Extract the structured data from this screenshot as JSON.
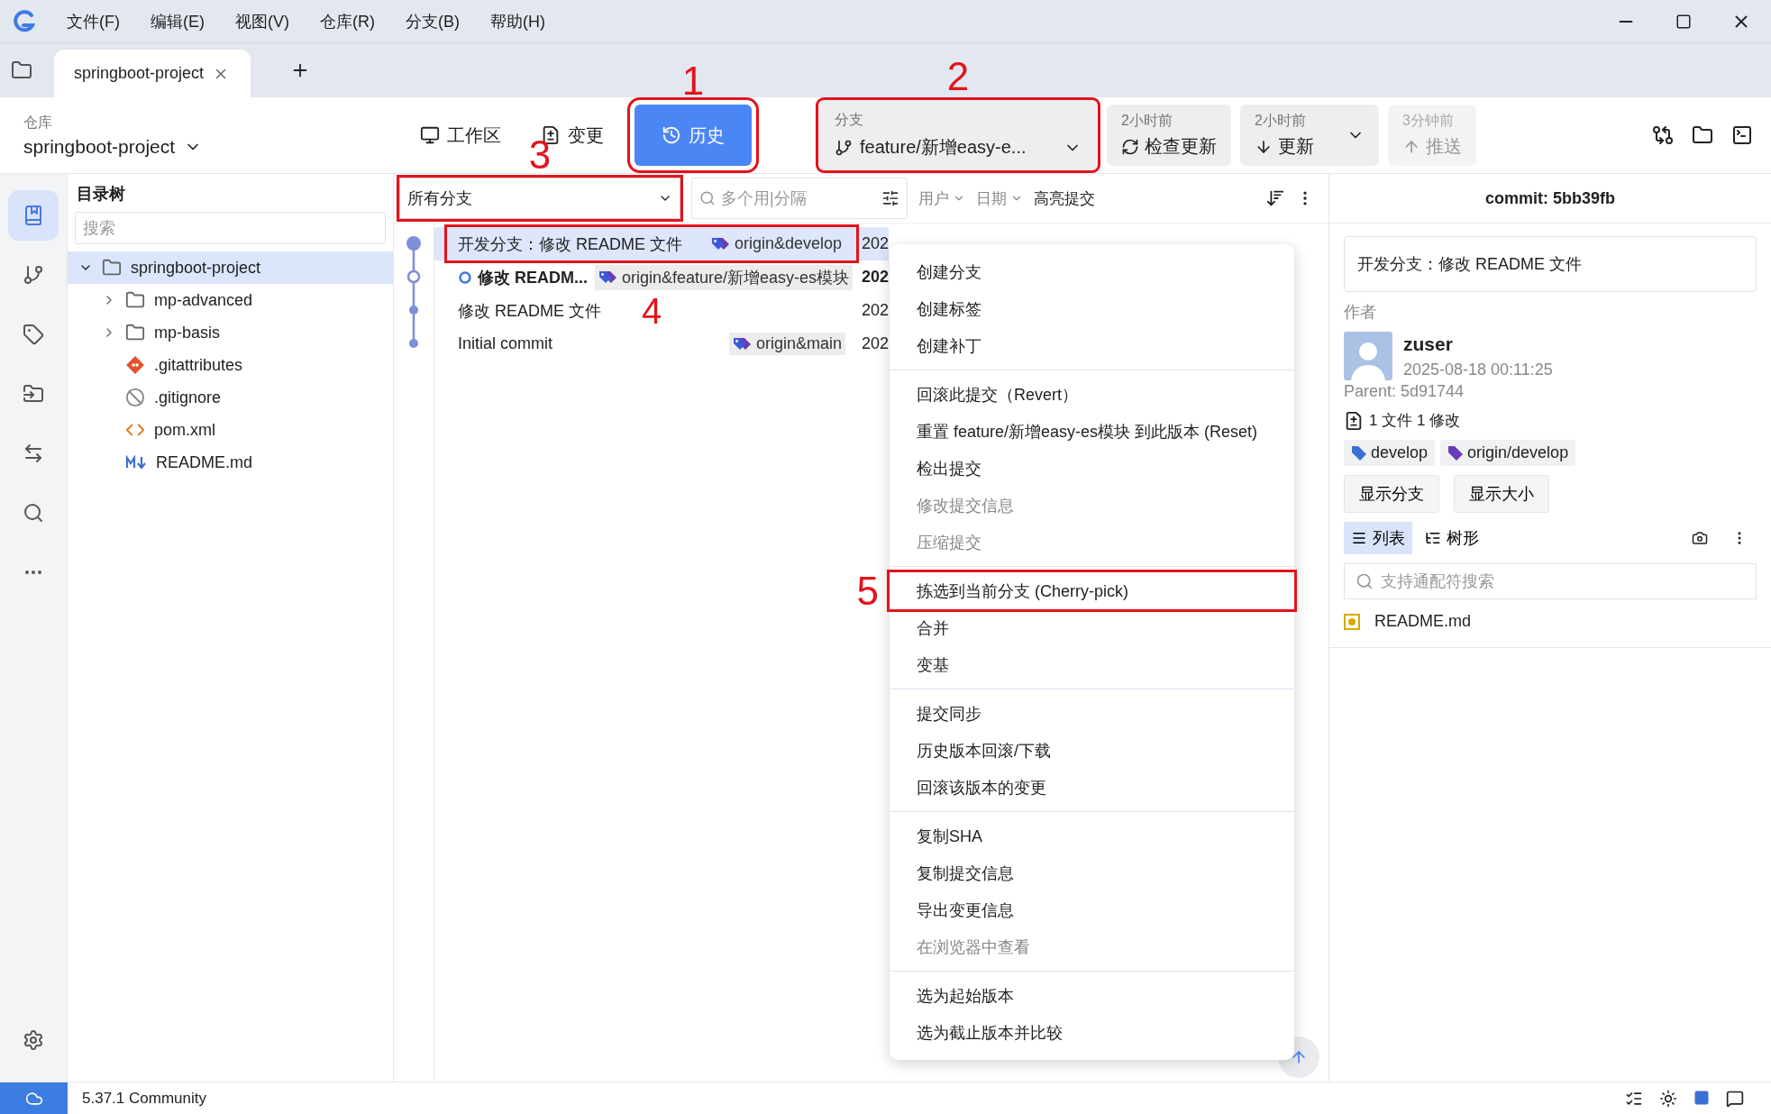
{
  "menu_bar": {
    "items": [
      "文件(F)",
      "编辑(E)",
      "视图(V)",
      "仓库(R)",
      "分支(B)",
      "帮助(H)"
    ]
  },
  "tabs": [
    {
      "label": "springboot-project",
      "selected": true
    }
  ],
  "toolbar": {
    "repo_label": "仓库",
    "repo_name": "springboot-project",
    "views": [
      {
        "label": "工作区",
        "selected": false
      },
      {
        "label": "变更",
        "selected": false
      },
      {
        "label": "历史",
        "selected": true,
        "annotation": "1"
      }
    ],
    "branch": {
      "label": "分支",
      "value": "feature/新增easy-e...",
      "annotation": "2"
    },
    "actions": [
      {
        "time": "2小时前",
        "label": "检查更新",
        "disabled": false,
        "dropdown": false
      },
      {
        "time": "2小时前",
        "label": "更新",
        "disabled": false,
        "dropdown": true
      },
      {
        "time": "3分钟前",
        "label": "推送",
        "disabled": true,
        "dropdown": false
      }
    ]
  },
  "rail": {
    "items": [
      {
        "selected": true
      },
      {
        "selected": false
      },
      {
        "selected": false
      },
      {
        "selected": false
      },
      {
        "selected": false
      },
      {
        "selected": false
      },
      {
        "selected": false
      }
    ]
  },
  "tree": {
    "title": "目录树",
    "search_placeholder": "搜索",
    "nodes": [
      {
        "name": "springboot-project",
        "kind": "folder",
        "expanded": true,
        "selected": true,
        "children": [
          {
            "name": "mp-advanced",
            "kind": "folder",
            "expanded": false,
            "selected": false
          },
          {
            "name": "mp-basis",
            "kind": "folder",
            "expanded": false,
            "selected": false
          },
          {
            "name": ".gitattributes",
            "kind": "git",
            "selected": false
          },
          {
            "name": ".gitignore",
            "kind": "ignore",
            "selected": false
          },
          {
            "name": "pom.xml",
            "kind": "xml",
            "selected": false
          },
          {
            "name": "README.md",
            "kind": "markdown",
            "selected": false
          }
        ]
      }
    ]
  },
  "history": {
    "branch_filter": {
      "value": "所有分支",
      "annotation": "3"
    },
    "search_placeholder": "多个用|分隔",
    "filters": [
      "用户",
      "日期"
    ],
    "highlight": "高亮提交",
    "commits": [
      {
        "message": "开发分支：修改 README 文件",
        "tag": "origin&develop",
        "date": "202",
        "selected": true,
        "current": false,
        "annotation": "4"
      },
      {
        "message": "修改 READM...",
        "tag": "origin&feature/新增easy-es模块",
        "date": "202",
        "selected": false,
        "current": true
      },
      {
        "message": "修改 README 文件",
        "date": "202",
        "selected": false,
        "current": false
      },
      {
        "message": "Initial commit",
        "tag": "origin&main",
        "date": "202",
        "selected": false,
        "current": false
      }
    ]
  },
  "context_menu": {
    "groups": [
      {
        "items": [
          {
            "label": "创建分支",
            "disabled": false
          },
          {
            "label": "创建标签",
            "disabled": false
          },
          {
            "label": "创建补丁",
            "disabled": false
          }
        ]
      },
      {
        "items": [
          {
            "label": "回滚此提交（Revert）",
            "disabled": false
          },
          {
            "label": "重置 feature/新增easy-es模块 到此版本 (Reset)",
            "disabled": false
          },
          {
            "label": "检出提交",
            "disabled": false
          },
          {
            "label": "修改提交信息",
            "disabled": true
          },
          {
            "label": "压缩提交",
            "disabled": true
          }
        ]
      },
      {
        "items": [
          {
            "label": "拣选到当前分支 (Cherry-pick)",
            "disabled": false,
            "annotation": "5"
          },
          {
            "label": "合并",
            "disabled": false
          },
          {
            "label": "变基",
            "disabled": false
          }
        ]
      },
      {
        "items": [
          {
            "label": "提交同步",
            "disabled": false
          },
          {
            "label": "历史版本回滚/下载",
            "disabled": false
          },
          {
            "label": "回滚该版本的变更",
            "disabled": false
          }
        ]
      },
      {
        "items": [
          {
            "label": "复制SHA",
            "disabled": false
          },
          {
            "label": "复制提交信息",
            "disabled": false
          },
          {
            "label": "导出变更信息",
            "disabled": false
          },
          {
            "label": "在浏览器中查看",
            "disabled": true
          }
        ]
      },
      {
        "items": [
          {
            "label": "选为起始版本",
            "disabled": false
          },
          {
            "label": "选为截止版本并比较",
            "disabled": false
          }
        ]
      }
    ]
  },
  "detail": {
    "title": "commit: 5bb39fb",
    "message": "开发分支：修改 README 文件",
    "author_label": "作者",
    "author": "zuser",
    "date": "2025-08-18 00:11:25",
    "parent": "Parent: 5d91744",
    "summary": "1 文件 1 修改",
    "refs": [
      {
        "name": "develop",
        "color": "#3b6fd6"
      },
      {
        "name": "origin/develop",
        "color": "#6a3bb5"
      }
    ],
    "buttons": [
      "显示分支",
      "显示大小"
    ],
    "view_tabs": [
      {
        "label": "列表",
        "selected": true
      },
      {
        "label": "树形",
        "selected": false
      }
    ],
    "file_search_placeholder": "支持通配符搜索",
    "files": [
      {
        "name": "README.md",
        "modified": true
      }
    ]
  },
  "status_bar": {
    "version": "5.37.1 Community"
  }
}
